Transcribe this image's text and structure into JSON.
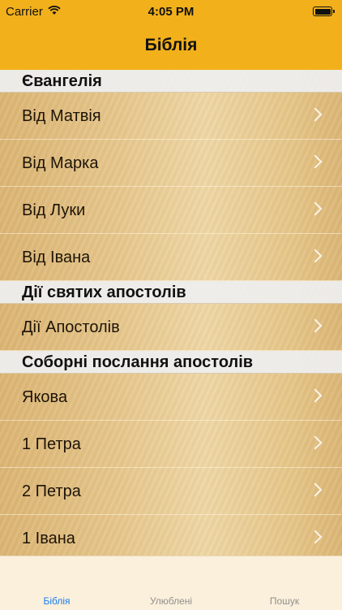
{
  "status_bar": {
    "carrier": "Carrier",
    "time": "4:05 PM"
  },
  "nav": {
    "title": "Біблія"
  },
  "sections": [
    {
      "title": "Євангелія",
      "items": [
        "Від Матвія",
        "Від Марка",
        "Від Луки",
        "Від Івана"
      ]
    },
    {
      "title": "Дії святих апостолів",
      "items": [
        "Дії Апостолів"
      ]
    },
    {
      "title": "Соборні послання апостолів",
      "items": [
        "Якова",
        "1 Петра",
        "2 Петра",
        "1 Івана"
      ]
    }
  ],
  "tabs": [
    {
      "label": "Біблія",
      "active": true
    },
    {
      "label": "Улюблені",
      "active": false
    },
    {
      "label": "Пошук",
      "active": false
    }
  ],
  "colors": {
    "bar": "#f2b01b",
    "accent": "#1a7cf0"
  }
}
